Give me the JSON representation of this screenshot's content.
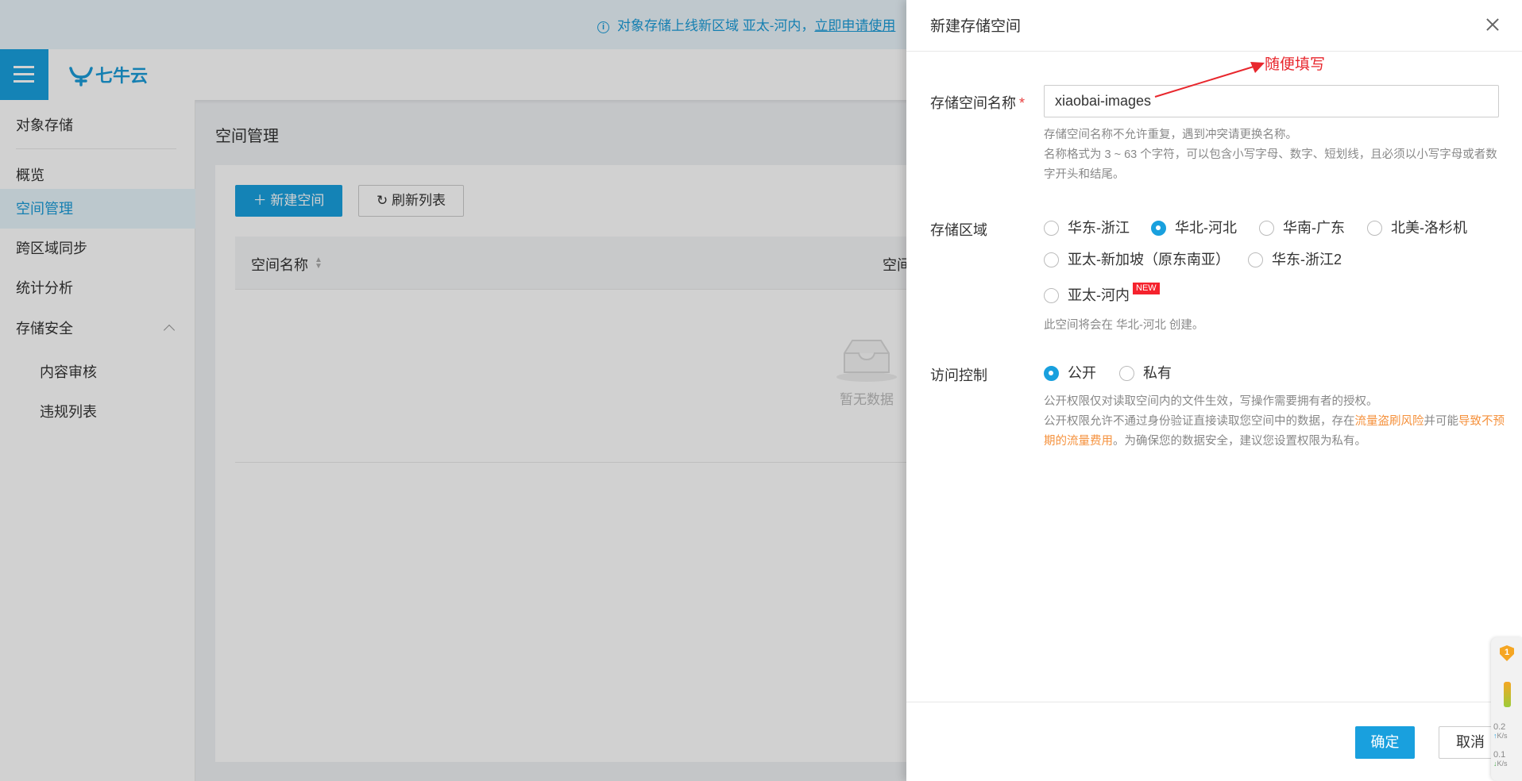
{
  "notice": {
    "info_icon": "info-circle-icon",
    "text": "对象存储上线新区域 亚太-河内，",
    "link": "立即申请使用"
  },
  "topbar": {
    "menu_icon": "hamburger-menu-icon",
    "logo_text": "七牛云",
    "brand_color": "#19a0de"
  },
  "sidebar": {
    "section_title": "对象存储",
    "items": [
      {
        "label": "概览"
      },
      {
        "label": "空间管理",
        "active": true
      },
      {
        "label": "跨区域同步"
      },
      {
        "label": "统计分析"
      },
      {
        "label": "存储安全",
        "expanded": true
      }
    ],
    "sub_items": [
      {
        "label": "内容审核"
      },
      {
        "label": "违规列表"
      }
    ]
  },
  "main": {
    "title": "空间管理",
    "new_button": "＋ 新建空间",
    "refresh_button": "刷新列表",
    "refresh_icon": "refresh-icon",
    "columns": [
      "空间名称",
      "空间标签"
    ],
    "empty_text": "暂无数据",
    "empty_icon": "empty-tray-icon"
  },
  "drawer": {
    "title": "新建存储空间",
    "close_icon": "close-icon",
    "name_field": {
      "label": "存储空间名称",
      "required_mark": "*",
      "value": "xiaobai-images",
      "help_line1": "存储空间名称不允许重复，遇到冲突请更换名称。",
      "help_line2": "名称格式为 3 ~ 63 个字符，可以包含小写字母、数字、短划线，且必须以小写字母或者数字开头和结尾。"
    },
    "region": {
      "label": "存储区域",
      "options": [
        {
          "label": "华东-浙江",
          "checked": false
        },
        {
          "label": "华北-河北",
          "checked": true
        },
        {
          "label": "华南-广东",
          "checked": false
        },
        {
          "label": "北美-洛杉机",
          "checked": false
        },
        {
          "label": "亚太-新加坡（原东南亚）",
          "checked": false
        },
        {
          "label": "华东-浙江2",
          "checked": false
        },
        {
          "label": "亚太-河内",
          "checked": false,
          "badge": "NEW"
        }
      ],
      "help": "此空间将会在 华北-河北 创建。"
    },
    "access": {
      "label": "访问控制",
      "options": [
        {
          "label": "公开",
          "checked": true
        },
        {
          "label": "私有",
          "checked": false
        }
      ],
      "help_line1": "公开权限仅对读取空间内的文件生效，写操作需要拥有者的授权。",
      "help_line2_a": "公开权限允许不通过身份验证直接读取您空间中的数据，存在",
      "help_line2_warn1": "流量盗刷风险",
      "help_line2_b": "并可能",
      "help_line2_warn2": "导致不预期的流量费用",
      "help_line2_c": "。为确保您的数据安全，建议您设置权限为私有。",
      "warn_color": "#f5913c"
    },
    "ok_button": "确定",
    "cancel_button": "取消"
  },
  "annotation": {
    "text": "随便填写",
    "color": "#e8272d"
  },
  "monitor": {
    "shield_icon": "shield-icon",
    "badge_count": "1",
    "upload": "0.2",
    "upload_unit": "K/s",
    "download": "0.1",
    "download_unit": "K/s"
  }
}
